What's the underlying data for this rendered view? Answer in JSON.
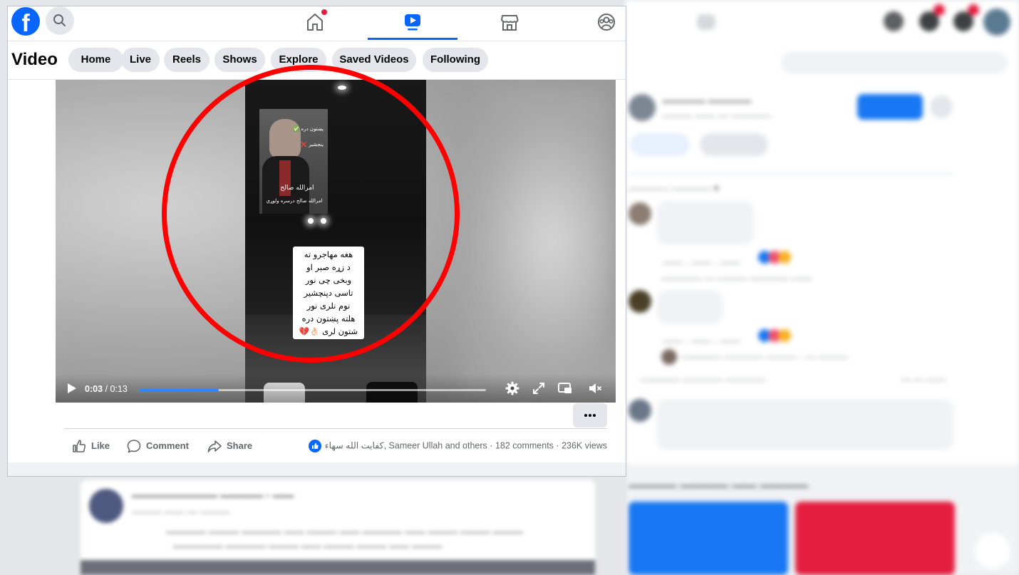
{
  "colors": {
    "brand": "#0866ff",
    "annotation_ring": "#ff0000",
    "notification": "#e41e3f",
    "pill_bg": "#e4e6eb",
    "secondary_text": "#65676b"
  },
  "topnav": {
    "logo_letter": "f",
    "icons": [
      "facebook-logo",
      "search-icon",
      "home-icon",
      "video-icon",
      "marketplace-icon",
      "groups-icon"
    ],
    "active_tab": "video"
  },
  "subnav": {
    "title": "Video",
    "tabs": [
      "Home",
      "Live",
      "Reels",
      "Shows",
      "Explore",
      "Saved Videos",
      "Following"
    ]
  },
  "player": {
    "current_time": "0:03",
    "separator": " / ",
    "duration": "0:13",
    "progress_fraction": 0.23,
    "muted": true,
    "overlay_caption": [
      "هغه مهاجرو ته",
      "د زړه صبر او",
      "وبخی چی نور",
      "تاسی دپنچشیر",
      "نوم نلری نور",
      "هلته پښتون دره",
      "شتون لری 👌🏻💔"
    ],
    "inner_clip_text": {
      "line1": "پښتون دره ✅",
      "line2": "پنجشیر ❌",
      "name": "امرالله صالح",
      "sub": "امرالله صالح درسره ولوړي"
    }
  },
  "actions": {
    "like": "Like",
    "comment": "Comment",
    "share": "Share"
  },
  "stats": {
    "reactors": "كفايت الله سهاء, Sameer Ullah and others",
    "comments": "182 comments",
    "views": "236K views",
    "dot": "·"
  }
}
